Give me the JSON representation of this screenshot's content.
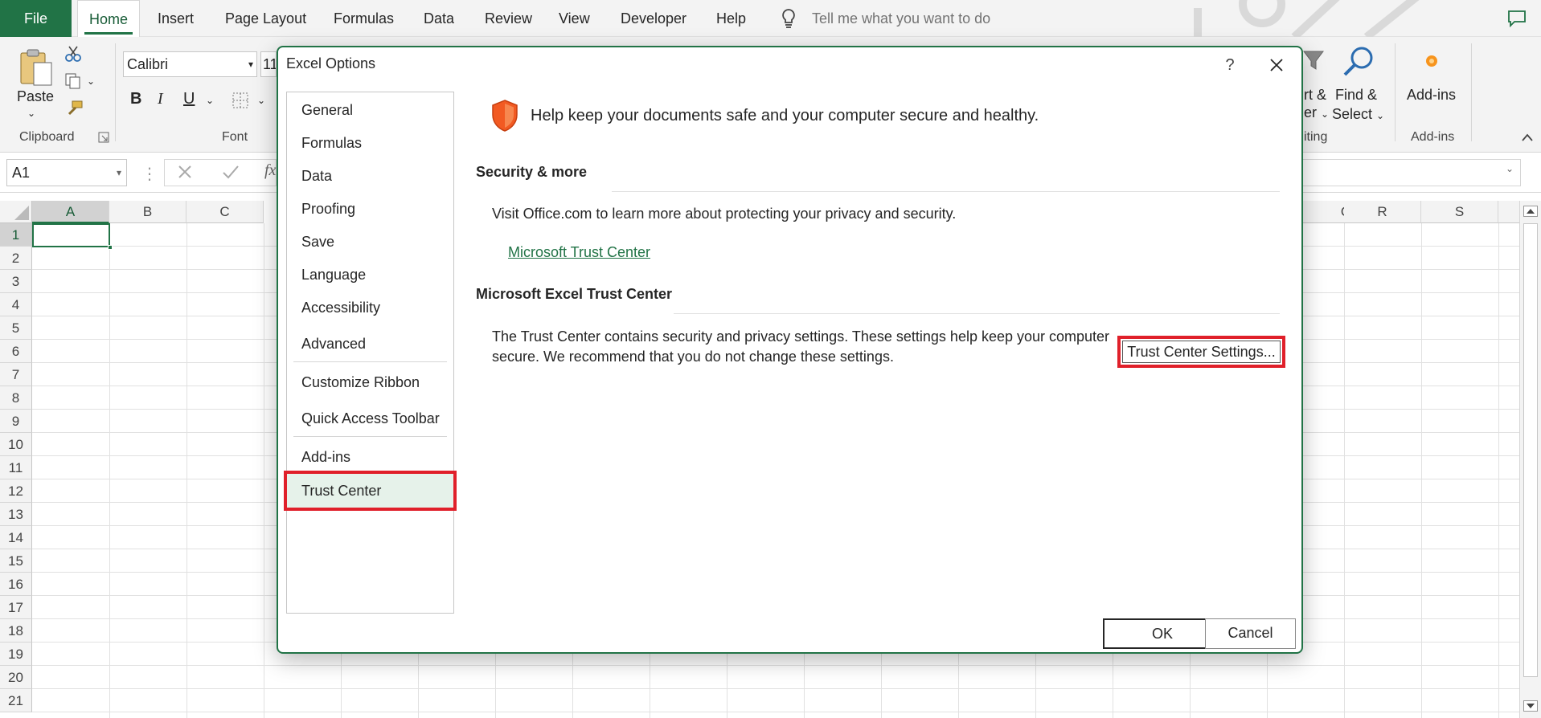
{
  "ribbon_tabs": [
    "File",
    "Home",
    "Insert",
    "Page Layout",
    "Formulas",
    "Data",
    "Review",
    "View",
    "Developer",
    "Help"
  ],
  "tell_me": "Tell me what you want to do",
  "ribbon": {
    "paste_label": "Paste",
    "clipboard_label": "Clipboard",
    "font_name": "Calibri",
    "font_size": "11",
    "font_label": "Font",
    "bold": "B",
    "italic": "I",
    "underline": "U",
    "sort_filter_label_line1": "rt &",
    "sort_filter_label_line2": "er",
    "editing_label": "iting",
    "find_select_line1": "Find &",
    "find_select_line2": "Select",
    "addins_label": "Add-ins",
    "addins_group_label": "Add-ins"
  },
  "formula_bar": {
    "name_box": "A1",
    "fx": "fx"
  },
  "grid": {
    "left_columns": [
      "A",
      "B",
      "C"
    ],
    "right_columns": [
      "Q",
      "R",
      "S"
    ],
    "rows": [
      "1",
      "2",
      "3",
      "4",
      "5",
      "6",
      "7",
      "8",
      "9",
      "10",
      "11",
      "12",
      "13",
      "14",
      "15",
      "16",
      "17",
      "18",
      "19",
      "20",
      "21"
    ]
  },
  "dialog": {
    "title": "Excel Options",
    "help": "?",
    "nav_items": [
      "General",
      "Formulas",
      "Data",
      "Proofing",
      "Save",
      "Language",
      "Accessibility",
      "Advanced",
      "Customize Ribbon",
      "Quick Access Toolbar",
      "Add-ins",
      "Trust Center"
    ],
    "active_nav": "Trust Center",
    "headline": "Help keep your documents safe and your computer secure and healthy.",
    "section1_title": "Security & more",
    "section1_text": "Visit Office.com to learn more about protecting your privacy and security.",
    "section1_link": "Microsoft Trust Center",
    "section2_title": "Microsoft Excel Trust Center",
    "section2_text_line1": "The Trust Center contains security and privacy settings. These settings help keep your computer",
    "section2_text_line2": "secure. We recommend that you do not change these settings.",
    "settings_button": "Trust Center Settings...",
    "ok_button": "OK",
    "cancel_button": "Cancel"
  },
  "colors": {
    "excel_green": "#217346",
    "highlight_red": "#e0202a",
    "shield_orange": "#f25a22"
  }
}
